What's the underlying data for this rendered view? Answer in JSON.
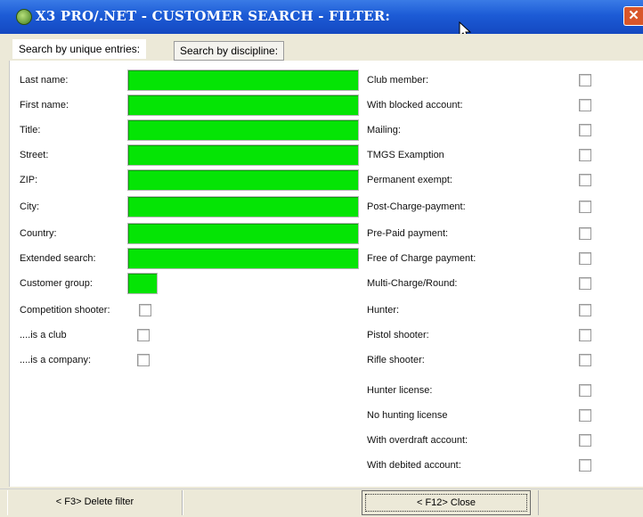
{
  "window": {
    "title": "X3 PRO/.NET - CUSTOMER SEARCH - FILTER:",
    "close_glyph": "✕",
    "accent": "#1c5bd6",
    "field_color": "#05e405"
  },
  "tabs": [
    {
      "label": "Search by unique entries:",
      "active": true
    },
    {
      "label": "Search by discipline:",
      "active": false
    }
  ],
  "left_fields": [
    {
      "label": "Last name:",
      "value": ""
    },
    {
      "label": "First name:",
      "value": ""
    },
    {
      "label": "Title:",
      "value": ""
    },
    {
      "label": "Street:",
      "value": ""
    },
    {
      "label": "ZIP:",
      "value": ""
    },
    {
      "label": "City:",
      "value": ""
    },
    {
      "label": "Country:",
      "value": ""
    },
    {
      "label": "Extended search:",
      "value": ""
    },
    {
      "label": "Customer group:",
      "value": ""
    }
  ],
  "left_checks": [
    {
      "label": "Competition shooter:",
      "checked": false
    },
    {
      "label": "....is a club",
      "checked": false
    },
    {
      "label": "....is a company:",
      "checked": false
    }
  ],
  "right_checks": [
    {
      "label": "Club member:",
      "checked": false
    },
    {
      "label": "With blocked account:",
      "checked": false
    },
    {
      "label": "Mailing:",
      "checked": false
    },
    {
      "label": "TMGS Examption",
      "checked": false
    },
    {
      "label": "Permanent exempt:",
      "checked": false
    },
    {
      "label": "Post-Charge-payment:",
      "checked": false
    },
    {
      "label": "Pre-Paid payment:",
      "checked": false
    },
    {
      "label": "Free of Charge payment:",
      "checked": false
    },
    {
      "label": "Multi-Charge/Round:",
      "checked": false
    },
    {
      "label": "Hunter:",
      "checked": false
    },
    {
      "label": "Pistol shooter:",
      "checked": false
    },
    {
      "label": "Rifle shooter:",
      "checked": false
    },
    {
      "label": "Hunter license:",
      "checked": false
    },
    {
      "label": "No hunting license",
      "checked": false
    },
    {
      "label": "With overdraft account:",
      "checked": false
    },
    {
      "label": "With debited account:",
      "checked": false
    }
  ],
  "footer": {
    "delete_label": "< F3> Delete filter",
    "close_label": "< F12> Close"
  }
}
